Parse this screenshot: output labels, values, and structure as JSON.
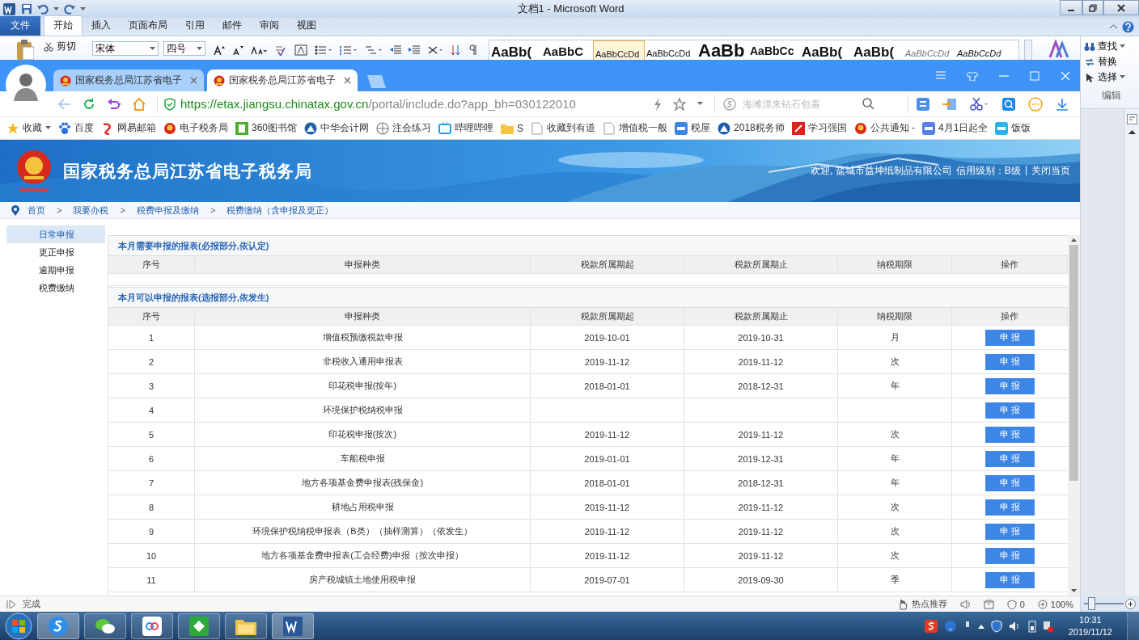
{
  "word": {
    "title": "文档1 - Microsoft Word",
    "tabs": [
      {
        "label": "文件",
        "kind": "file",
        "selected": false
      },
      {
        "label": "开始",
        "kind": "tab",
        "selected": true
      },
      {
        "label": "插入",
        "kind": "tab",
        "selected": false
      },
      {
        "label": "页面布局",
        "kind": "tab",
        "selected": false
      },
      {
        "label": "引用",
        "kind": "tab",
        "selected": false
      },
      {
        "label": "邮件",
        "kind": "tab",
        "selected": false
      },
      {
        "label": "审阅",
        "kind": "tab",
        "selected": false
      },
      {
        "label": "视图",
        "kind": "tab",
        "selected": false
      }
    ],
    "clipboard": {
      "cut": "剪切"
    },
    "font": {
      "name": "宋体",
      "size": "四号"
    },
    "styles": [
      {
        "sample": "AaBb(",
        "kind": "h1",
        "selected": false
      },
      {
        "sample": "AaBbC",
        "kind": "h2",
        "selected": false
      },
      {
        "sample": "AaBbCcDd",
        "kind": "plain",
        "selected": true
      },
      {
        "sample": "AaBbCcDd",
        "kind": "plain",
        "selected": false
      },
      {
        "sample": "AaBb",
        "kind": "title",
        "selected": false
      },
      {
        "sample": "AaBbCc",
        "kind": "h3",
        "selected": false
      },
      {
        "sample": "AaBb(",
        "kind": "h1",
        "selected": false
      },
      {
        "sample": "AaBb(",
        "kind": "h1",
        "selected": false
      },
      {
        "sample": "AaBbCcDd",
        "kind": "subtle",
        "selected": false
      },
      {
        "sample": "AaBbCcDd",
        "kind": "emphasis",
        "selected": false
      }
    ],
    "editing": {
      "find": "查找",
      "replace": "替换",
      "select": "选择",
      "group": "编辑"
    },
    "zoom_slider": {
      "level": 0.1
    }
  },
  "browser": {
    "tabs": [
      {
        "title": "国家税务总局江苏省电子",
        "selected": false
      },
      {
        "title": "国家税务总局江苏省电子",
        "selected": true
      }
    ],
    "address": {
      "host": "https://etax.jiangsu.chinatax.gov.cn",
      "path": "/portal/include.do?app_bh=030122010"
    },
    "search": {
      "placeholder": "海滩漂来钻石包裹"
    },
    "bookmarks": [
      {
        "label": "收藏",
        "kind": "menu"
      },
      {
        "label": "百度",
        "kind": "link"
      },
      {
        "label": "网易邮箱",
        "kind": "link"
      },
      {
        "label": "电子税务局",
        "kind": "link"
      },
      {
        "label": "360图书馆",
        "kind": "link"
      },
      {
        "label": "中华会计网",
        "kind": "link"
      },
      {
        "label": "注会练习",
        "kind": "link"
      },
      {
        "label": "哔哩哔哩",
        "kind": "link"
      },
      {
        "label": "S",
        "kind": "link"
      },
      {
        "label": "收藏到有道",
        "kind": "link"
      },
      {
        "label": "增值税一般",
        "kind": "link"
      },
      {
        "label": "税屋",
        "kind": "link"
      },
      {
        "label": "2018税务师",
        "kind": "link"
      },
      {
        "label": "学习强国",
        "kind": "link"
      },
      {
        "label": "公共通知 -",
        "kind": "link"
      },
      {
        "label": "4月1日起全",
        "kind": "link"
      },
      {
        "label": "饭饭",
        "kind": "link"
      }
    ],
    "status_bar": {
      "text": "完成",
      "hot": "热点推荐",
      "count": "0",
      "zoom": "100%"
    }
  },
  "page": {
    "site_title": "国家税务总局江苏省电子税务局",
    "welcome": "欢迎, 盐城市益坤纸制品有限公司",
    "credit": "信用级别：B级",
    "divider": "|",
    "close": "关闭当页",
    "breadcrumb": [
      {
        "label": "首页"
      },
      {
        "separator": ">",
        "label": "我要办税"
      },
      {
        "separator": ">",
        "label": "税费申报及缴纳"
      },
      {
        "separator": ">",
        "label": "税费缴纳（含申报及更正）"
      }
    ],
    "sidebar": [
      {
        "label": "日常申报",
        "selected": true
      },
      {
        "label": "更正申报",
        "selected": false
      },
      {
        "label": "逾期申报",
        "selected": false
      },
      {
        "label": "税费缴纳",
        "selected": false
      }
    ],
    "sections": [
      {
        "title": "本月需要申报的报表(必报部分,依认定)",
        "columns": [
          "序号",
          "申报种类",
          "税款所属期起",
          "税款所属期止",
          "纳税期限",
          "操作"
        ]
      },
      {
        "title": "本月可以申报的报表(选报部分,依发生)",
        "columns": [
          "序号",
          "申报种类",
          "税款所属期起",
          "税款所属期止",
          "纳税期限",
          "操作"
        ],
        "rows": [
          {
            "no": "1",
            "name": "增值税预缴税款申报",
            "start": "2019-10-01",
            "end": "2019-10-31",
            "period": "月",
            "action": "申 报"
          },
          {
            "no": "2",
            "name": "非税收入通用申报表",
            "start": "2019-11-12",
            "end": "2019-11-12",
            "period": "次",
            "action": "申 报"
          },
          {
            "no": "3",
            "name": "印花税申报(按年)",
            "start": "2018-01-01",
            "end": "2018-12-31",
            "period": "年",
            "action": "申 报"
          },
          {
            "no": "4",
            "name": "环境保护税纳税申报",
            "action": "申 报"
          },
          {
            "no": "5",
            "name": "印花税申报(按次)",
            "start": "2019-11-12",
            "end": "2019-11-12",
            "period": "次",
            "action": "申 报"
          },
          {
            "no": "6",
            "name": "车船税申报",
            "start": "2019-01-01",
            "end": "2019-12-31",
            "period": "年",
            "action": "申 报"
          },
          {
            "no": "7",
            "name": "地方各项基金费申报表(残保金)",
            "start": "2018-01-01",
            "end": "2018-12-31",
            "period": "年",
            "action": "申 报"
          },
          {
            "no": "8",
            "name": "耕地占用税申报",
            "start": "2019-11-12",
            "end": "2019-11-12",
            "period": "次",
            "action": "申 报"
          },
          {
            "no": "9",
            "name": "环境保护税纳税申报表（B类）（抽样测算）（依发生）",
            "start": "2019-11-12",
            "end": "2019-11-12",
            "period": "次",
            "action": "申 报"
          },
          {
            "no": "10",
            "name": "地方各项基金费申报表(工会经费)申报（按次申报）",
            "start": "2019-11-12",
            "end": "2019-11-12",
            "period": "次",
            "action": "申 报"
          },
          {
            "no": "11",
            "name": "房产税城镇土地使用税申报",
            "start": "2019-07-01",
            "end": "2019-09-30",
            "period": "季",
            "action": "申 报"
          }
        ]
      }
    ]
  },
  "taskbar": {
    "time": "10:31",
    "date": "2019/11/12"
  }
}
